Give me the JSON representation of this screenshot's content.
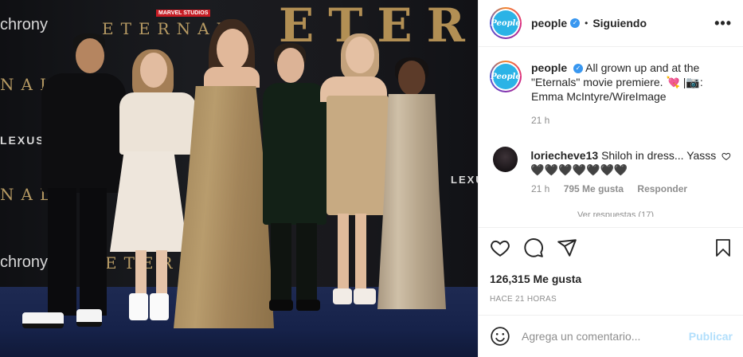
{
  "photo": {
    "banners": {
      "left_top": "chrony",
      "title_top": "ETERNALS",
      "marvel": "MARVEL STUDIOS",
      "left_mid": "NALS",
      "lexus_left": "LEXUS",
      "lexus_right": "LEXUS",
      "title_bottom": "ETERNALS",
      "left_bottom": "chrony",
      "big_letters": "ETER",
      "left_lower": "NAL"
    }
  },
  "post": {
    "header": {
      "avatar_text": "People",
      "username": "people",
      "verified": "✓",
      "separator": "•",
      "follow_status": "Siguiendo",
      "more": "•••"
    },
    "caption": {
      "username": "people",
      "text": "All grown up and at the \"Eternals\" movie premiere. 💘 |📷: Emma McIntyre/WireImage",
      "time": "21 h"
    },
    "comment": {
      "username": "loriecheve13",
      "text": "Shiloh in dress... Yasss 🖤🖤🖤🖤🖤🖤🖤",
      "time": "21 h",
      "likes": "795 Me gusta",
      "reply": "Responder",
      "view_replies": "Ver respuestas (17)"
    },
    "likes": "126,315 Me gusta",
    "posted_ago": "HACE 21 HORAS",
    "composer": {
      "placeholder": "Agrega un comentario...",
      "submit": "Publicar"
    }
  }
}
